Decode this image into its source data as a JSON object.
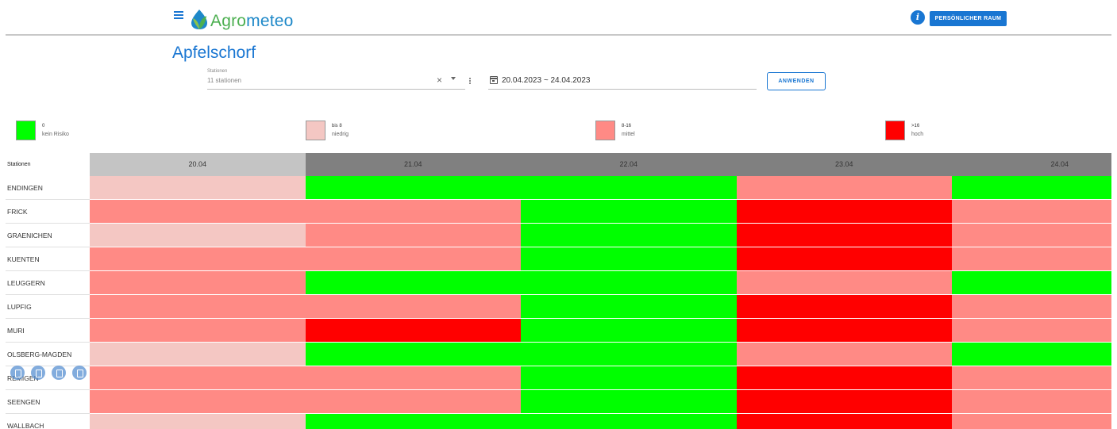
{
  "app": {
    "logo_agro": "Agro",
    "logo_meteo": "meteo",
    "info_label": "i",
    "space_button": "PERSÖNLICHER RAUM"
  },
  "page": {
    "title": "Apfelschorf"
  },
  "filters": {
    "stations_label": "Stationen",
    "stations_value": "11 stationen",
    "clear_icon": "×",
    "date_range": "20.04.2023 ~ 24.04.2023",
    "apply_button": "ANWENDEN"
  },
  "colors": {
    "none": "#00ff00",
    "low": "#f4c7c3",
    "medium": "#ff8a85",
    "high": "#ff0000",
    "header_first": "#c4c4c4",
    "header_rest": "#808080",
    "accent": "#1976d2"
  },
  "legend": [
    {
      "value": "0",
      "label": "kein Risiko",
      "level": "none"
    },
    {
      "value": "bis 8",
      "label": "niedrig",
      "level": "low"
    },
    {
      "value": "8-16",
      "label": "mittel",
      "level": "medium"
    },
    {
      "value": ">16",
      "label": "hoch",
      "level": "high"
    }
  ],
  "table": {
    "station_header": "Stationen",
    "days": [
      "20.04",
      "21.04",
      "22.04",
      "23.04",
      "24.04"
    ],
    "rows": [
      {
        "station": "ENDINGEN",
        "levels": [
          "low",
          "none",
          "none",
          "medium",
          "none"
        ]
      },
      {
        "station": "FRICK",
        "levels": [
          "medium",
          "medium",
          "none",
          "high",
          "medium"
        ]
      },
      {
        "station": "GRAENICHEN",
        "levels": [
          "low",
          "medium",
          "none",
          "high",
          "medium"
        ]
      },
      {
        "station": "KUENTEN",
        "levels": [
          "medium",
          "medium",
          "none",
          "high",
          "medium"
        ]
      },
      {
        "station": "LEUGGERN",
        "levels": [
          "medium",
          "none",
          "none",
          "medium",
          "none"
        ]
      },
      {
        "station": "LUPFIG",
        "levels": [
          "medium",
          "medium",
          "none",
          "high",
          "medium"
        ]
      },
      {
        "station": "MURI",
        "levels": [
          "medium",
          "high",
          "none",
          "high",
          "medium"
        ]
      },
      {
        "station": "OLSBERG-MAGDEN",
        "levels": [
          "low",
          "none",
          "none",
          "medium",
          "none"
        ]
      },
      {
        "station": "REMIGEN",
        "levels": [
          "medium",
          "medium",
          "none",
          "high",
          "medium"
        ]
      },
      {
        "station": "SEENGEN",
        "levels": [
          "medium",
          "medium",
          "none",
          "high",
          "medium"
        ]
      },
      {
        "station": "WALLBACH",
        "levels": [
          "low",
          "none",
          "none",
          "high",
          "medium"
        ]
      }
    ]
  },
  "floating_actions": [
    "info-action-icon",
    "list-action-icon",
    "calendar-action-icon",
    "bookmark-action-icon"
  ]
}
